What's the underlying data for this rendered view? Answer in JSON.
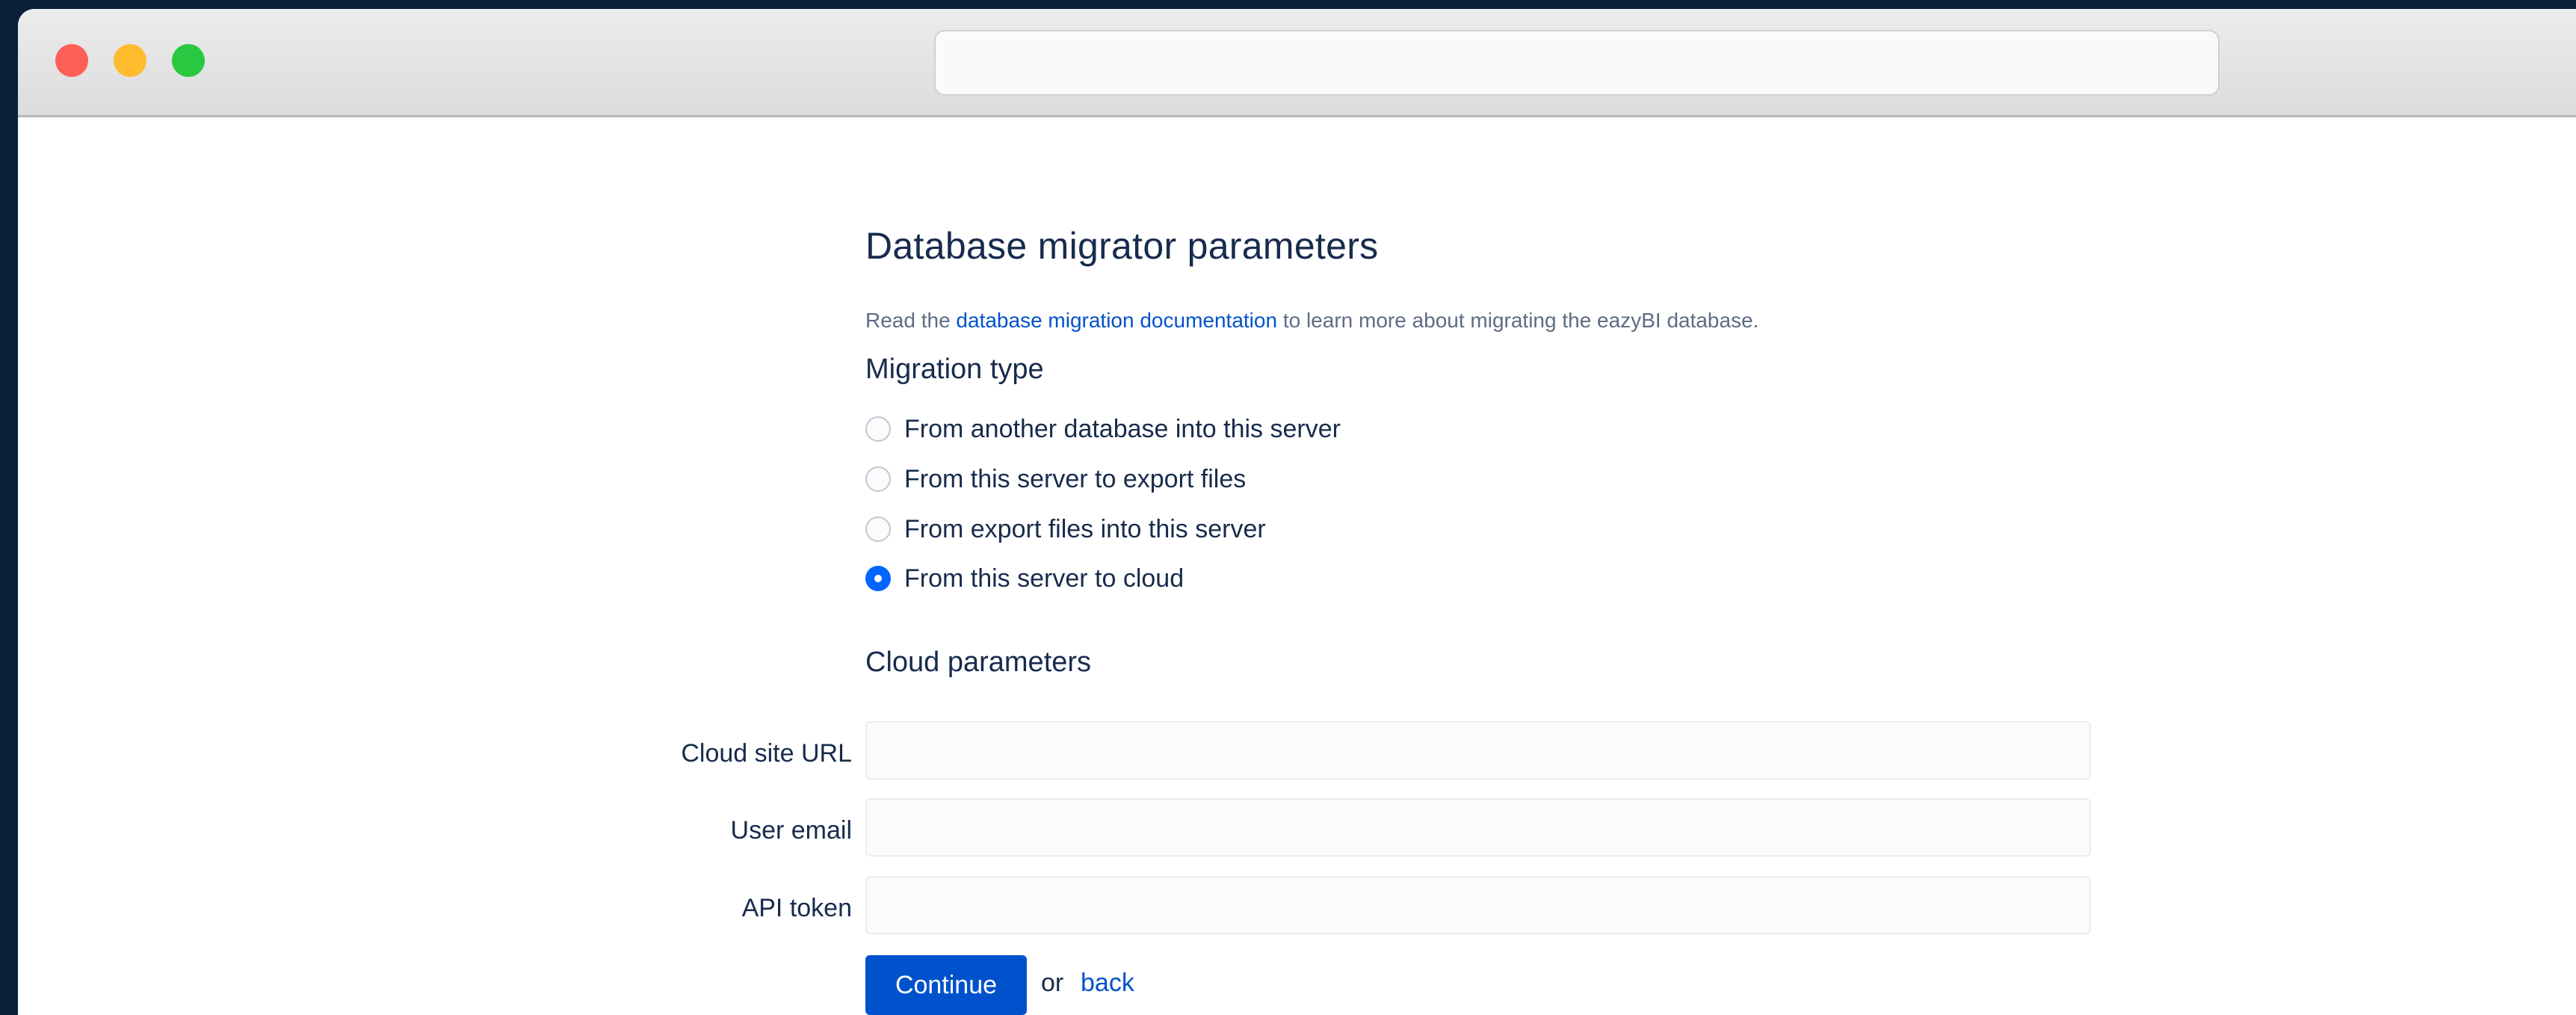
{
  "page": {
    "title": "Database migrator parameters",
    "intro": {
      "prefix": "Read the ",
      "link": "database migration documentation",
      "suffix": " to learn more about migrating the eazyBI database."
    }
  },
  "migration_type": {
    "heading": "Migration type",
    "options": [
      {
        "label": "From another database into this server",
        "checked": false
      },
      {
        "label": "From this server to export files",
        "checked": false
      },
      {
        "label": "From export files into this server",
        "checked": false
      },
      {
        "label": "From this server to cloud",
        "checked": true
      }
    ]
  },
  "cloud_parameters": {
    "heading": "Cloud parameters",
    "fields": [
      {
        "label": "Cloud site URL",
        "value": ""
      },
      {
        "label": "User email",
        "value": ""
      },
      {
        "label": "API token",
        "value": ""
      }
    ]
  },
  "actions": {
    "continue_label": "Continue",
    "or_text": "or",
    "back_label": "back"
  },
  "colors": {
    "accent": "#0052cc",
    "radio_checked": "#0065ff",
    "text": "#172b4d",
    "muted": "#5e6c84",
    "frame": "#0c1f3a"
  }
}
